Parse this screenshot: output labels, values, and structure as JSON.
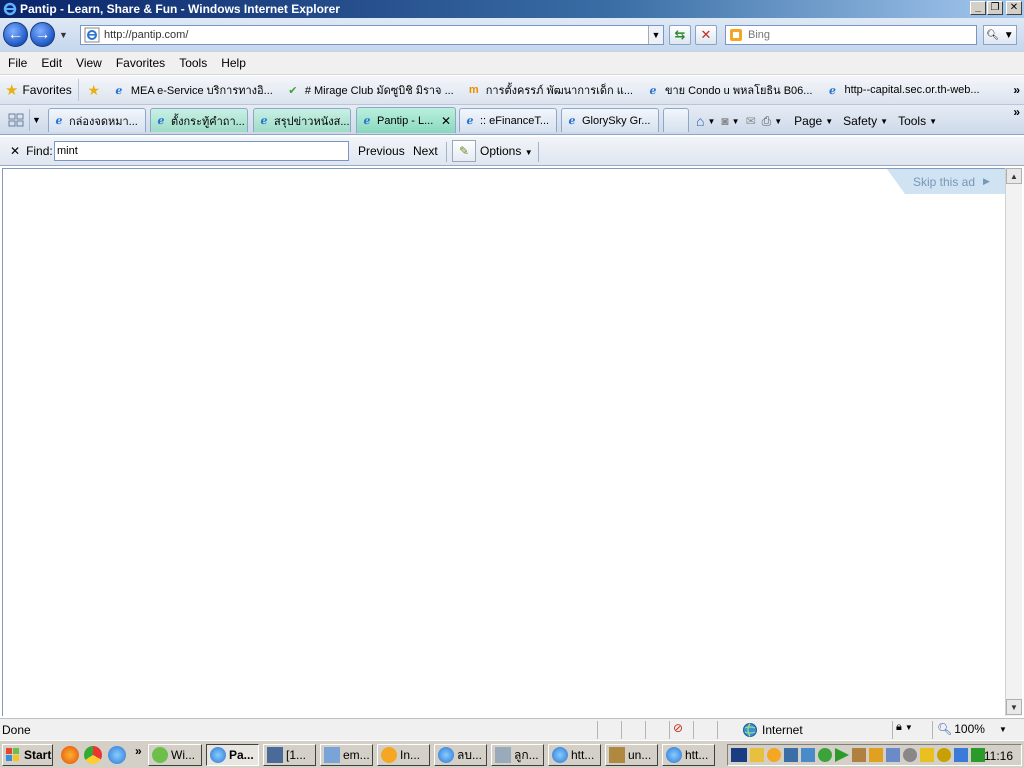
{
  "window": {
    "title": "Pantip - Learn, Share & Fun - Windows Internet Explorer"
  },
  "navigation": {
    "address": "http://pantip.com/",
    "search_placeholder": "Bing"
  },
  "menu": [
    "File",
    "Edit",
    "View",
    "Favorites",
    "Tools",
    "Help"
  ],
  "favorites_bar": {
    "favorites_label": "Favorites",
    "links": [
      {
        "label": "MEA e-Service บริการทางอิ...",
        "icon": "ie-icon"
      },
      {
        "label": "# Mirage Club มัดซูบิชิ มิราจ ...",
        "icon": "check-icon"
      },
      {
        "label": "การตั้งครรภ์ พัฒนาการเด็ก แ...",
        "icon": "m-logo-icon"
      },
      {
        "label": "ขาย Condo u พหลโยธิน B06...",
        "icon": "ie-icon"
      },
      {
        "label": "http--capital.sec.or.th-web...",
        "icon": "ie-icon"
      }
    ]
  },
  "tabs": [
    {
      "label": "กล่องจดหมา...",
      "active": false,
      "color": "plain"
    },
    {
      "label": "ตั้งกระทู้คำถา...",
      "active": false,
      "color": "green"
    },
    {
      "label": "สรุปข่าวหนังส...",
      "active": false,
      "color": "green"
    },
    {
      "label": "Pantip - L...",
      "active": true,
      "color": "green"
    },
    {
      "label": ":: eFinanceT...",
      "active": false,
      "color": "plain"
    },
    {
      "label": "GlorySky Gr...",
      "active": false,
      "color": "plain"
    }
  ],
  "command_bar": {
    "page": "Page",
    "safety": "Safety",
    "tools": "Tools"
  },
  "find_bar": {
    "label": "Find:",
    "query": "mint",
    "previous": "Previous",
    "next": "Next",
    "options": "Options"
  },
  "content": {
    "skip_ad": "Skip this ad"
  },
  "status_bar": {
    "status": "Done",
    "zone": "Internet",
    "zoom": "100%"
  },
  "taskbar": {
    "start": "Start",
    "tasks": [
      {
        "label": "Wi...",
        "active": false
      },
      {
        "label": "Pa...",
        "active": true
      },
      {
        "label": "[1...",
        "active": false
      },
      {
        "label": "em...",
        "active": false
      },
      {
        "label": "In...",
        "active": false
      },
      {
        "label": "ลบ...",
        "active": false
      },
      {
        "label": "ลูก...",
        "active": false
      },
      {
        "label": "htt...",
        "active": false
      },
      {
        "label": "un...",
        "active": false
      },
      {
        "label": "htt...",
        "active": false
      }
    ],
    "clock": "11:16"
  }
}
